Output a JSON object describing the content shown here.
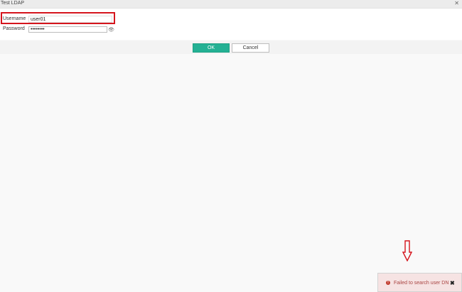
{
  "window": {
    "title": "Test LDAP",
    "close_icon": "close-icon"
  },
  "form": {
    "username_label": "Username",
    "username_value": "user01",
    "password_label": "Password",
    "password_value": "••••••••",
    "password_toggle_icon": "eye-icon"
  },
  "buttons": {
    "ok_label": "OK",
    "cancel_label": "Cancel"
  },
  "toast": {
    "icon": "error-icon",
    "message": "Failed to search user DN",
    "close_icon": "close-icon"
  },
  "colors": {
    "highlight": "#d5151d",
    "ok_button": "#24b194",
    "error_text": "#a94442",
    "error_background": "#f6e3e3"
  }
}
